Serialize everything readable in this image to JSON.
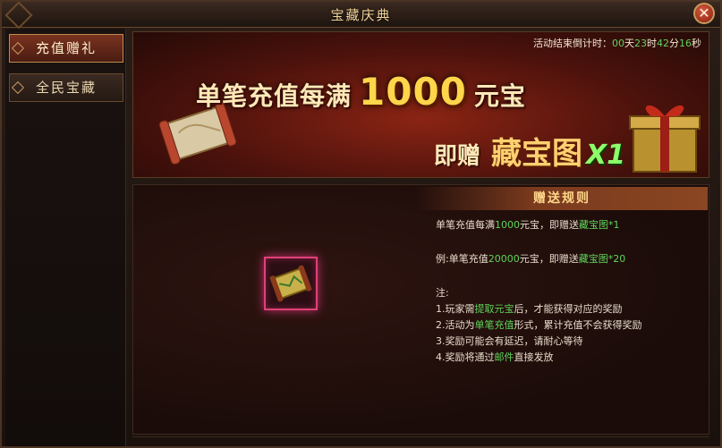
{
  "window": {
    "title": "宝藏庆典",
    "close_symbol": "✕"
  },
  "sidebar": {
    "items": [
      {
        "label": "充值赠礼",
        "active": true
      },
      {
        "label": "全民宝藏",
        "active": false
      }
    ]
  },
  "banner": {
    "countdown": {
      "label": "活动结束倒计时：",
      "days": "00",
      "days_unit": "天",
      "hours": "23",
      "hours_unit": "时",
      "minutes": "42",
      "minutes_unit": "分",
      "seconds": "16",
      "seconds_unit": "秒"
    },
    "headline_prefix": "单笔充值每满",
    "headline_amount": "1000",
    "headline_suffix": "元宝",
    "sub_prefix": "即赠",
    "sub_item": "藏宝图",
    "sub_mult": "X1"
  },
  "rules": {
    "header": "赠送规则",
    "line1": {
      "a": "单笔充值每满",
      "b": "1000",
      "c": "元宝，即赠送",
      "d": "藏宝图*1"
    },
    "line2": {
      "a": "例:单笔充值",
      "b": "20000",
      "c": "元宝，即赠送",
      "d": "藏宝图*20"
    },
    "note_label": "注:",
    "note1": {
      "a": "1.玩家需",
      "b": "提取元宝",
      "c": "后，才能获得对应的奖励"
    },
    "note2": {
      "a": "2.活动为",
      "b": "单笔充值",
      "c": "形式，累计充值不会获得奖励"
    },
    "note3": "3.奖励可能会有延迟，请耐心等待",
    "note4": {
      "a": "4.奖励将通过",
      "b": "邮件",
      "c": "直接发放"
    }
  },
  "colors": {
    "highlight": "#5fd35b",
    "accent": "#ffd54a",
    "frame": "#6b4a2c"
  }
}
